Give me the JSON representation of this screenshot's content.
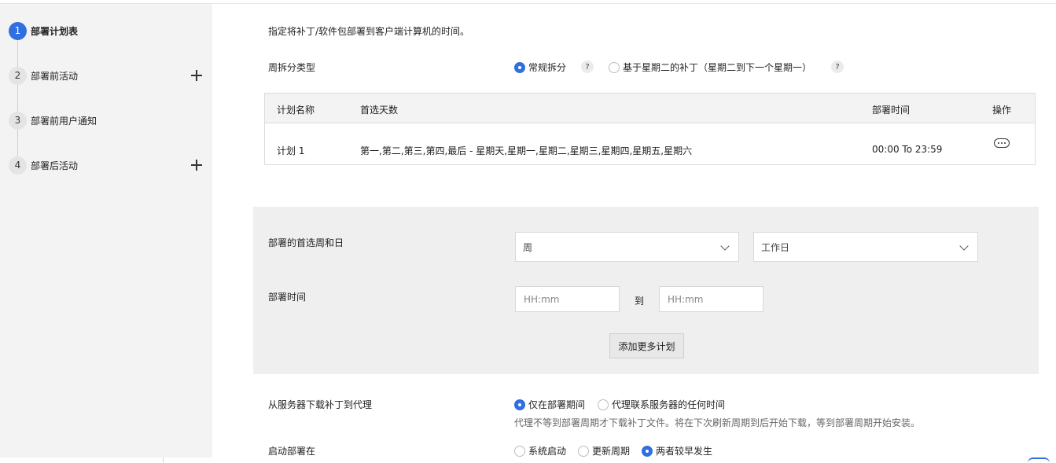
{
  "sidebar": {
    "steps": [
      {
        "num": "1",
        "label": "部署计划表"
      },
      {
        "num": "2",
        "label": "部署前活动"
      },
      {
        "num": "3",
        "label": "部署前用户通知"
      },
      {
        "num": "4",
        "label": "部署后活动"
      }
    ]
  },
  "main": {
    "description": "指定将补丁/软件包部署到客户端计算机的时间。",
    "week_split": {
      "label": "周拆分类型",
      "options": [
        "常规拆分",
        "基于星期二的补丁（星期二到下一个星期一）"
      ],
      "selected": "常规拆分",
      "help": "?"
    },
    "table": {
      "headers": {
        "name": "计划名称",
        "days": "首选天数",
        "time": "部署时间",
        "action": "操作"
      },
      "rows": [
        {
          "name": "计划 1",
          "days": "第一,第二,第三,第四,最后 - 星期天,星期一,星期二,星期三,星期四,星期五,星期六",
          "time": "00:00 To 23:59"
        }
      ]
    },
    "panel": {
      "preferred_label": "部署的首选周和日",
      "week_select": "周",
      "day_select": "工作日",
      "time_label": "部署时间",
      "time_from_placeholder": "HH:mm",
      "time_to": "到",
      "time_to_placeholder": "HH:mm",
      "add_button": "添加更多计划"
    },
    "download": {
      "label": "从服务器下载补丁到代理",
      "options": [
        "仅在部署期间",
        "代理联系服务器的任何时间"
      ],
      "selected": "仅在部署期间",
      "note": "代理不等到部署周期才下载补丁文件。将在下次刷新周期到后开始下载，等到部署周期开始安装。"
    },
    "start_deploy": {
      "label": "启动部署在",
      "options": [
        "系统启动",
        "更新周期",
        "两者较早发生"
      ],
      "selected": "两者较早发生"
    }
  },
  "colors": {
    "accent": "#2f6fe0",
    "panel": "#efefef",
    "sidebar": "#f3f3f3"
  }
}
